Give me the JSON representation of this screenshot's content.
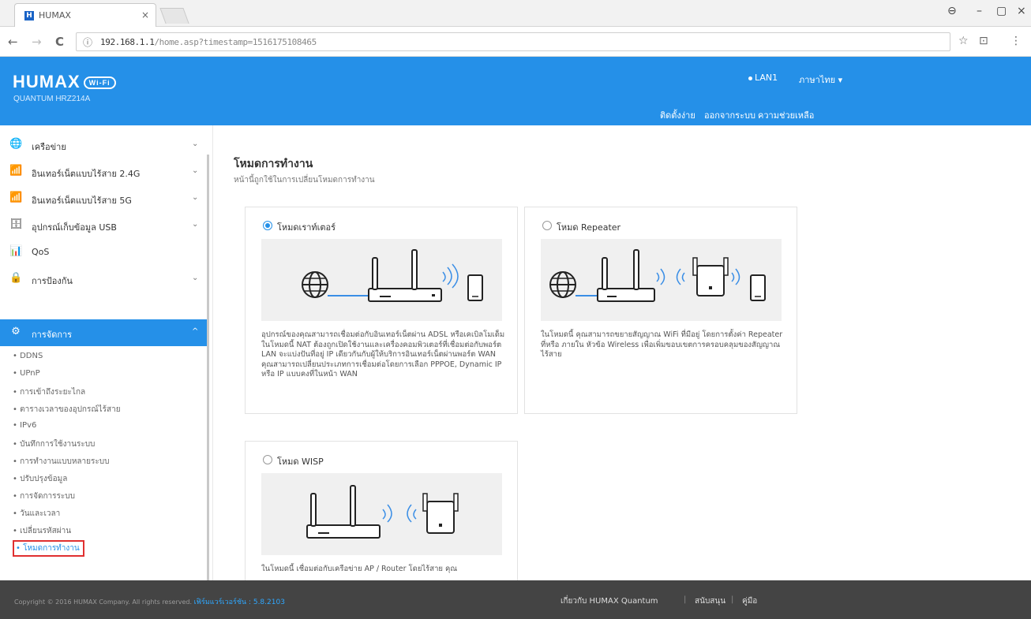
{
  "browser": {
    "tab_title": "HUMAX",
    "tab_close": "×",
    "favicon_letter": "H",
    "url_host": "192.168.1.1",
    "url_path": "/home.asp?timestamp=1516175108465",
    "controls": {
      "account": "⊖",
      "minimize": "–",
      "maximize": "▢",
      "close": "×"
    },
    "nav": {
      "back": "←",
      "forward": "→",
      "reload": "C",
      "info": "ⓘ"
    },
    "toolbar": {
      "star": "☆",
      "cast": "⊡",
      "menu": "⋮"
    }
  },
  "header": {
    "brand": "HUMAX",
    "brand_badge": "Wi-Fi",
    "model": "QUANTUM HRZ214A",
    "lan_status": "LAN1",
    "language": "ภาษาไทย ▾",
    "nav": [
      "ติดตั้งง่าย",
      "ออกจากระบบ",
      "ความช่วยเหลือ"
    ]
  },
  "sidebar": {
    "items": [
      {
        "icon": "🌐",
        "label": "เครือข่าย",
        "chevron": "⌄"
      },
      {
        "icon": "📶",
        "label": "อินเทอร์เน็ตแบบไร้สาย 2.4G",
        "chevron": "⌄"
      },
      {
        "icon": "📶",
        "label": "อินเทอร์เน็ตแบบไร้สาย 5G",
        "chevron": "⌄"
      },
      {
        "icon": "🗄",
        "label": "อุปกรณ์เก็บข้อมูล USB",
        "chevron": "⌄"
      },
      {
        "icon": "📊",
        "label": "QoS",
        "chevron": ""
      },
      {
        "icon": "🔒",
        "label": "การป้องกัน",
        "chevron": "⌄"
      },
      {
        "icon": "⚙",
        "label": "การจัดการ",
        "chevron": "^"
      }
    ],
    "sub_items": [
      "DDNS",
      "UPnP",
      "การเข้าถึงระยะไกล",
      "ตารางเวลาของอุปกรณ์ไร้สาย",
      "IPv6",
      "บันทึกการใช้งานระบบ",
      "การทำงานแบบหลายระบบ",
      "ปรับปรุงข้อมูล",
      "การจัดการระบบ",
      "วันและเวลา",
      "เปลี่ยนรหัสผ่าน",
      "โหมดการทำงาน"
    ],
    "bullet": "•"
  },
  "main": {
    "title": "โหมดการทำงาน",
    "subtitle": "หน้านี้ถูกใช้ในการเปลี่ยนโหมดการทำงาน",
    "cards": [
      {
        "label": "โหมดเราท์เตอร์",
        "checked": true,
        "desc": "อุปกรณ์ของคุณสามารถเชื่อมต่อกับอินเทอร์เน็ตผ่าน ADSL หรือเคเบิลโมเด็มในโหมดนี้ NAT ต้องถูกเปิดใช้งานและเครื่องคอมพิวเตอร์ที่เชื่อมต่อกับพอร์ต LAN จะแบ่งปันที่อยู่ IP เดียวกันกับผู้ให้บริการอินเทอร์เน็ตผ่านพอร์ต WAN คุณสามารถเปลี่ยนประเภทการเชื่อมต่อโดยการเลือก PPPOE, Dynamic IP หรือ IP แบบคงที่ในหน้า WAN"
      },
      {
        "label": "โหมด Repeater",
        "checked": false,
        "desc": "ในโหมดนี้ คุณสามารถขยายสัญญาณ WiFi ที่มีอยู่ โดยการตั้งค่า Repeater ที่หรือ ภายใน หัวข้อ Wireless เพื่อเพิ่มขอบเขตการครอบคลุมของสัญญาณไร้สาย"
      },
      {
        "label": "โหมด WISP",
        "checked": false,
        "desc": "ในโหมดนี้ เชื่อมต่อกับเครือข่าย AP / Router โดยไร้สาย คุณ"
      }
    ]
  },
  "footer": {
    "copyright": "Copyright © 2016 HUMAX Company. All rights reserved.",
    "firmware": "เฟิร์มแวร์เวอร์ชัน : 5.8.2103",
    "links": [
      "เกี่ยวกับ HUMAX Quantum",
      "สนับสนุน",
      "คู่มือ"
    ],
    "separator": "|"
  },
  "colors": {
    "accent": "#2590e8",
    "footer": "#444444",
    "highlight": "#e03030"
  }
}
